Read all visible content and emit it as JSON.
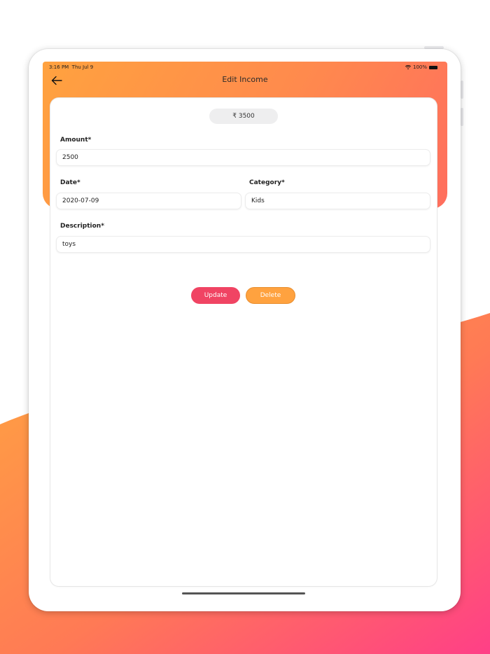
{
  "status_bar": {
    "time": "3:16 PM",
    "date": "Thu Jul 9",
    "battery": "100%"
  },
  "header": {
    "title": "Edit Income"
  },
  "summary": {
    "total": "₹ 3500"
  },
  "form": {
    "amount": {
      "label": "Amount*",
      "value": "2500"
    },
    "date": {
      "label": "Date*",
      "value": "2020-07-09"
    },
    "category": {
      "label": "Category*",
      "value": "Kids"
    },
    "description": {
      "label": "Description*",
      "value": "toys"
    }
  },
  "actions": {
    "update_label": "Update",
    "delete_label": "Delete"
  },
  "colors": {
    "accent_orange": "#ffa23f",
    "accent_pink": "#f04463",
    "gradient_end": "#ff3d87"
  }
}
